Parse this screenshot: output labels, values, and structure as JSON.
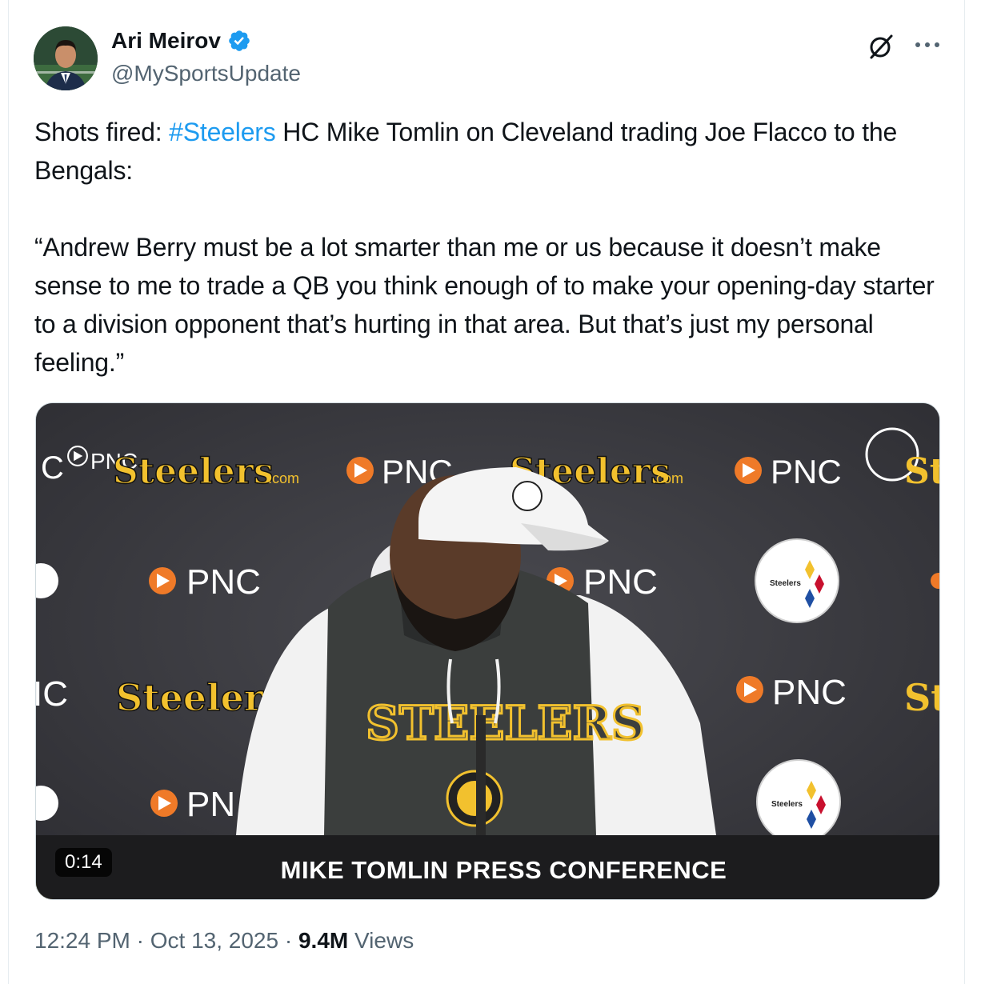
{
  "author": {
    "display_name": "Ari Meirov",
    "handle": "@MySportsUpdate",
    "verified": true
  },
  "icons": {
    "verified": "verified-badge-icon",
    "grok": "grok-icon",
    "more": "more-options-icon"
  },
  "tweet": {
    "line1_prefix": "Shots fired: ",
    "hashtag": "#Steelers",
    "line1_suffix": " HC Mike Tomlin on Cleveland trading Joe Flacco to the Bengals:",
    "quote": "“Andrew Berry must be a lot smarter than me or us because it doesn’t make sense to me to trade a QB you think enough of to make your opening-day starter to a division opponent that’s hurting in that area. But that’s just my personal feeling.”"
  },
  "media": {
    "type": "video",
    "duration": "0:14",
    "caption": "MIKE TOMLIN PRESS CONFERENCE",
    "backdrop_text": {
      "steelers": "Steelers",
      "steelers_com": ".com",
      "pnc": "PNC",
      "shirt": "STEELERS"
    }
  },
  "footer": {
    "time": "12:24 PM",
    "separator": " · ",
    "date": "Oct 13, 2025",
    "views_count": "9.4M",
    "views_label": " Views"
  },
  "colors": {
    "link": "#1d9bf0",
    "secondary_text": "#536471",
    "primary_text": "#0f1419",
    "steelers_gold": "#f2c12e",
    "pnc_orange": "#ef7a28"
  }
}
